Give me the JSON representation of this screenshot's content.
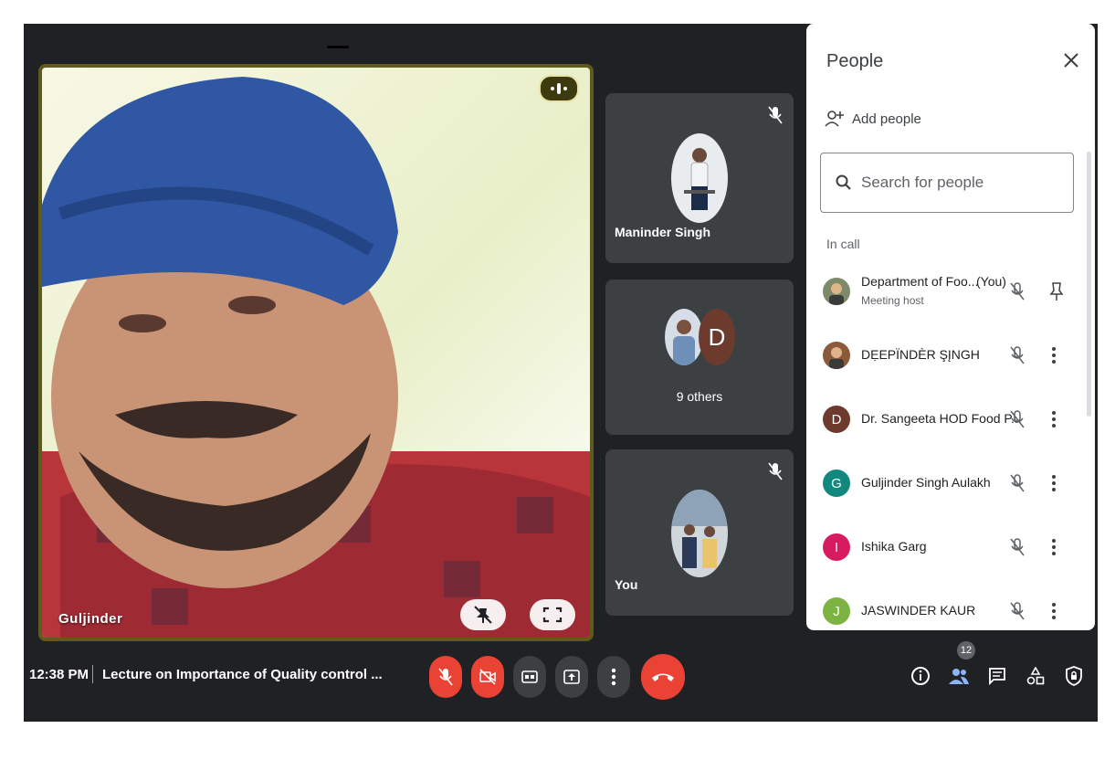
{
  "main_tile": {
    "name": "Guljinder"
  },
  "tiles": {
    "maninder": {
      "name": "Maninder Singh"
    },
    "others": {
      "label": "9 others",
      "avatar_letter": "D"
    },
    "you": {
      "name": "You"
    }
  },
  "panel": {
    "title": "People",
    "add_people": "Add people",
    "search_placeholder": "Search for people",
    "section": "In call",
    "participants": [
      {
        "name": "Department of Foo...",
        "you": "(You)",
        "role": "Meeting host",
        "avatar": "photo"
      },
      {
        "name": "DẸEPÏNDÈR ŞĮNGH",
        "avatar": "photo"
      },
      {
        "name": "Dr. Sangeeta HOD Food P...",
        "letter": "D",
        "color": "#6d3a2e"
      },
      {
        "name": "Guljinder Singh Aulakh",
        "letter": "G",
        "color": "#12877d"
      },
      {
        "name": "Ishika Garg",
        "letter": "I",
        "color": "#d81b60"
      },
      {
        "name": "JASWINDER KAUR",
        "letter": "J",
        "color": "#7cb342"
      }
    ]
  },
  "bottom_bar": {
    "time": "12:38 PM",
    "meeting_title": "Lecture on Importance of Quality control ...",
    "participant_count": "12"
  },
  "colors": {
    "danger": "#ea4335",
    "surface": "#202124",
    "tile": "#3c4043"
  }
}
